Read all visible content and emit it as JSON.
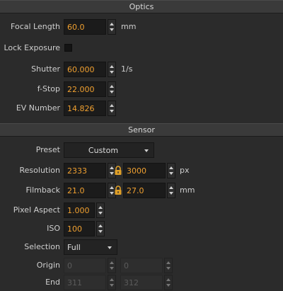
{
  "optics": {
    "header": "Optics",
    "focal_length": {
      "label": "Focal Length",
      "value": "60.0",
      "unit": "mm"
    },
    "lock_exposure": {
      "label": "Lock Exposure",
      "checked": false
    },
    "shutter": {
      "label": "Shutter",
      "value": "60.000",
      "unit": "1/s"
    },
    "fstop": {
      "label": "f-Stop",
      "value": "22.000"
    },
    "ev": {
      "label": "EV Number",
      "value": "14.826"
    }
  },
  "sensor": {
    "header": "Sensor",
    "preset": {
      "label": "Preset",
      "value": "Custom"
    },
    "resolution": {
      "label": "Resolution",
      "width": "2333",
      "height": "3000",
      "unit": "px"
    },
    "filmback": {
      "label": "Filmback",
      "width": "21.0",
      "height": "27.0",
      "unit": "mm"
    },
    "pixel_aspect": {
      "label": "Pixel Aspect",
      "value": "1.000"
    },
    "iso": {
      "label": "ISO",
      "value": "100"
    },
    "selection": {
      "label": "Selection",
      "value": "Full"
    },
    "origin": {
      "label": "Origin",
      "x": "0",
      "y": "0"
    },
    "end": {
      "label": "End",
      "x": "311",
      "y": "312"
    }
  },
  "colors": {
    "accent_value": "#f0a030",
    "lock_icon": "#e0a028",
    "background": "#2b2b2b"
  },
  "icons": {
    "lock": "lock-icon",
    "stepper": "stepper-arrows-icon",
    "dropdown": "chevron-down-icon"
  }
}
